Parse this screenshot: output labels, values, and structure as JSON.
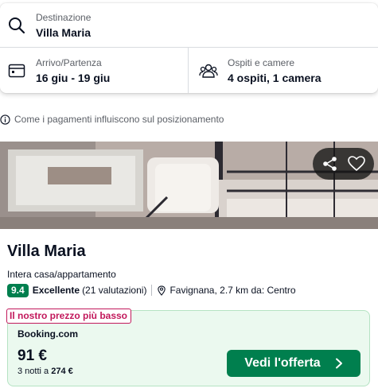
{
  "search": {
    "destination_label": "Destinazione",
    "destination_value": "Villa Maria",
    "dates_label": "Arrivo/Partenza",
    "dates_value": "16 giu - 19 giu",
    "guests_label": "Ospiti e camere",
    "guests_value": "4 ospiti, 1 camera"
  },
  "info_notice": "Come i pagamenti influiscono sul posizionamento",
  "hotel": {
    "name": "Villa Maria",
    "type": "Intera casa/appartamento",
    "score": "9.4",
    "rating_label": "Excellente",
    "rating_count": "(21 valutazioni)",
    "location": "Favignana, 2.7 km da: Centro"
  },
  "deal": {
    "badge": "Il nostro prezzo più basso",
    "provider": "Booking.com",
    "price": "91 €",
    "nights_prefix": "3 notti a ",
    "total": "274 €",
    "cta_label": "Vedi l'offerta"
  },
  "icons": [
    "search-icon",
    "calendar-icon",
    "guests-icon",
    "info-icon",
    "share-icon",
    "heart-icon",
    "location-pin-icon",
    "chevron-right-icon"
  ],
  "colors": {
    "accent_green": "#007f4e",
    "deal_bg": "#ebf9ef",
    "badge_red": "#c2185b"
  }
}
